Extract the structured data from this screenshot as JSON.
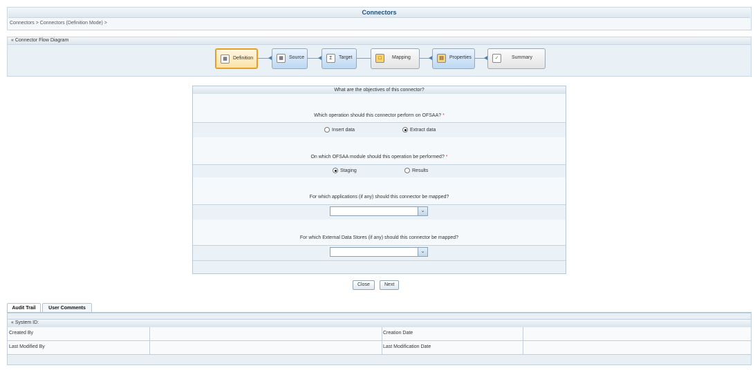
{
  "header": {
    "title": "Connectors",
    "breadcrumb": "Connectors > Connectors (Definition Mode) >"
  },
  "flow": {
    "section_label": "Connector Flow Diagram",
    "steps": [
      {
        "label": "Definition",
        "icon": "definition-icon",
        "state": "active"
      },
      {
        "label": "Source",
        "icon": "source-icon",
        "state": "enabled"
      },
      {
        "label": "Target",
        "icon": "target-icon",
        "state": "enabled"
      },
      {
        "label": "Mapping",
        "icon": "mapping-icon",
        "state": "default"
      },
      {
        "label": "Properties",
        "icon": "properties-icon",
        "state": "enabled"
      },
      {
        "label": "Summary",
        "icon": "summary-icon",
        "state": "default"
      }
    ]
  },
  "objectives": {
    "title": "What are the objectives of this connector?",
    "q1": {
      "text": "Which operation should this connector perform on OFSAA?",
      "required_mark": "*",
      "options": [
        "Insert data",
        "Extract data"
      ],
      "selected": "Extract data"
    },
    "q2": {
      "text": "On which OFSAA module should this operation be performed?",
      "required_mark": "*",
      "options": [
        "Staging",
        "Results"
      ],
      "selected": "Staging"
    },
    "q3": {
      "text": "For which applications (if any) should this connector be mapped?",
      "value": ""
    },
    "q4": {
      "text": "For which External Data Stores (if any) should this connector be mapped?",
      "value": ""
    }
  },
  "actions": {
    "close": "Close",
    "next": "Next"
  },
  "audit": {
    "tabs": [
      "Audit Trail",
      "User Comments"
    ],
    "active_tab": "Audit Trail",
    "section_label": "System ID:",
    "fields": {
      "created_by": "Created By",
      "creation_date": "Creation Date",
      "last_modified_by": "Last Modified By",
      "last_modification_date": "Last Modification Date"
    },
    "values": {
      "created_by": "",
      "creation_date": "",
      "last_modified_by": "",
      "last_modification_date": ""
    }
  },
  "colors": {
    "title_text": "#1f4e79",
    "panel_bg": "#eaf2f7",
    "active_step_border": "#e6a023",
    "required": "#dd4444"
  }
}
